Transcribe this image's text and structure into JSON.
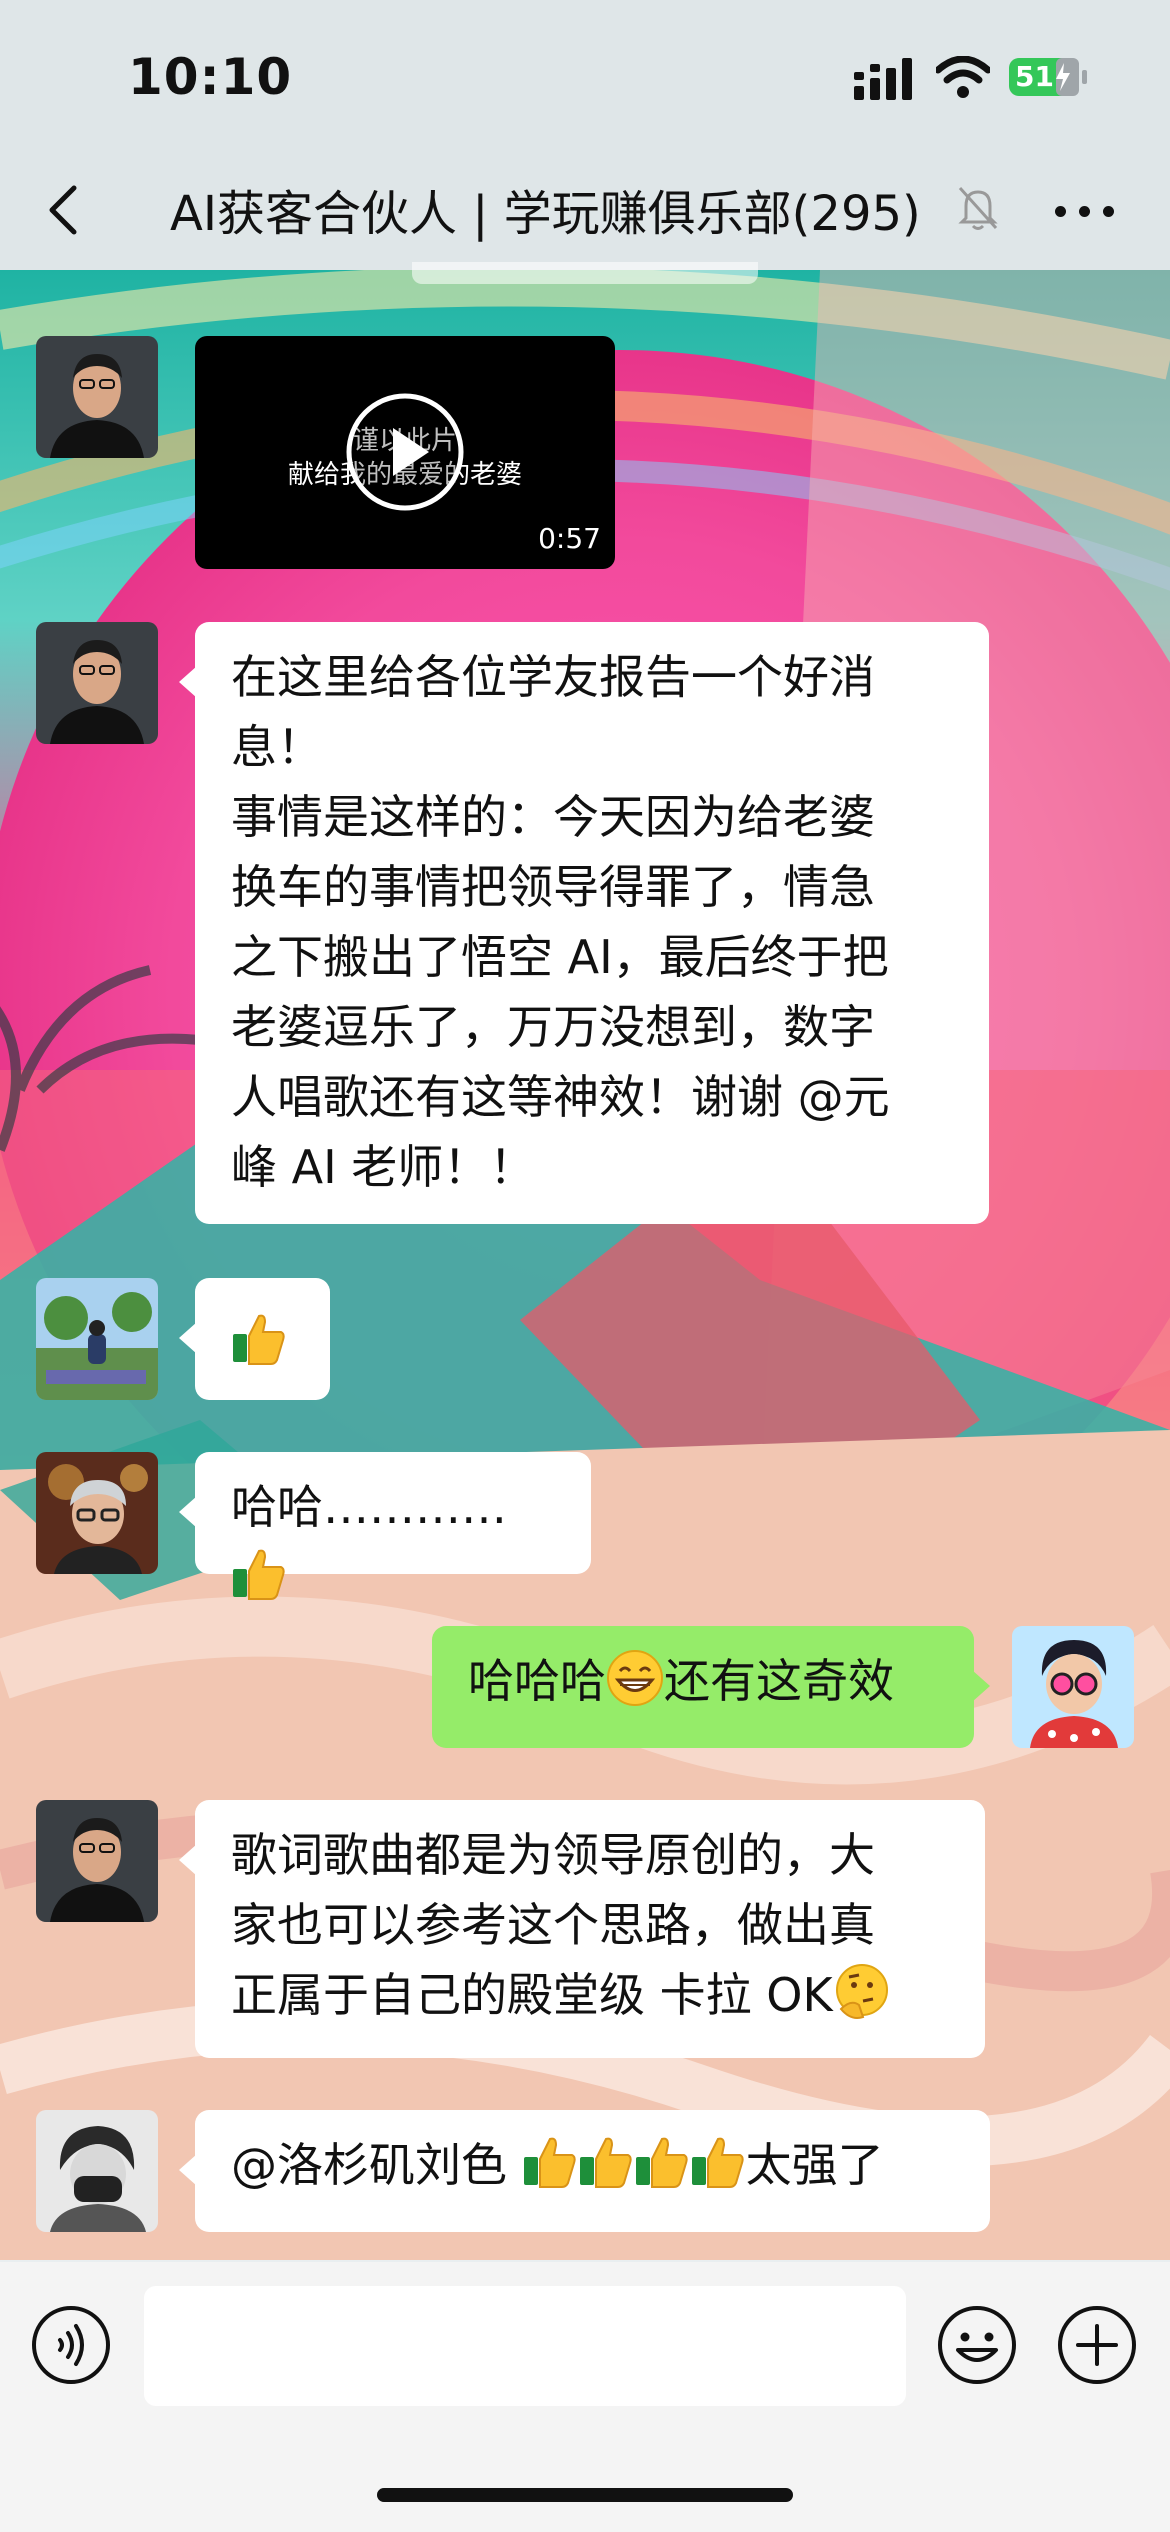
{
  "status_bar": {
    "time": "10:10",
    "battery": "51"
  },
  "nav": {
    "title": "AI获客合伙人 | 学玩赚俱乐部(295)",
    "back_icon": "chevron-left-icon",
    "mute_icon": "bell-slash-icon",
    "more_icon": "ellipsis-icon"
  },
  "messages": [
    {
      "type": "video",
      "caption_line1": "谨以此片",
      "caption_line2": "献给我的最爱的老婆",
      "duration": "0:57"
    },
    {
      "type": "text",
      "lines": [
        "在这里给各位学友报告一个好消",
        "息！",
        "事情是这样的：今天因为给老婆",
        "换车的事情把领导得罪了，情急",
        "之下搬出了悟空 AI，最后终于把",
        "老婆逗乐了，万万没想到，数字",
        "人唱歌还有这等神效！谢谢 @元",
        "峰 AI 老师！！"
      ]
    },
    {
      "type": "emoji",
      "emoji": "thumbs-up"
    },
    {
      "type": "text",
      "text": "哈哈…………",
      "emoji": "thumbs-up"
    },
    {
      "type": "text",
      "outgoing": true,
      "text_before": "哈哈哈",
      "emoji": "grinning-face",
      "text_after": "还有这奇效"
    },
    {
      "type": "text",
      "lines": [
        "歌词歌曲都是为领导原创的，大",
        "家也可以参考这个思路，做出真",
        "正属于自己的殿堂级 卡拉 OK"
      ],
      "emoji": "thinking-face"
    },
    {
      "type": "text",
      "text_before": "@洛杉矶刘色 ",
      "emoji": "thumbs-up x4",
      "text_after": "太强了"
    }
  ],
  "input_bar": {
    "voice_icon": "voice-icon",
    "emoji_icon": "smiley-icon",
    "plus_icon": "plus-circle-icon"
  }
}
